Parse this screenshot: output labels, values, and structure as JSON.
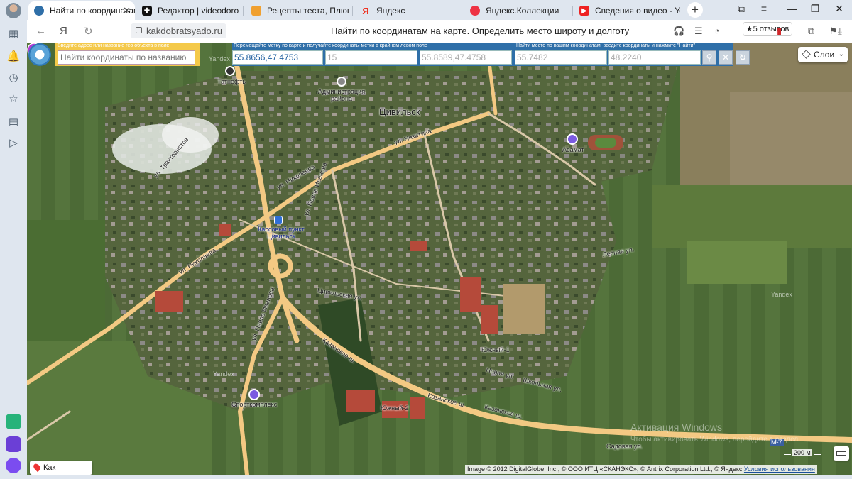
{
  "tabs": [
    {
      "label": "Найти по координатам",
      "favicon": "kakdobratsyado-icon",
      "active": true
    },
    {
      "label": "Редактор | videodorogros",
      "favicon": "zen-editor-icon"
    },
    {
      "label": "Рецепты теста, Плюшка к",
      "favicon": "recipe-site-icon"
    },
    {
      "label": "Яндекс",
      "favicon": "yandex-icon"
    },
    {
      "label": "Яндекс.Коллекции",
      "favicon": "yandex-collections-icon"
    },
    {
      "label": "Сведения о видео - YouT",
      "favicon": "youtube-icon"
    }
  ],
  "address_bar": {
    "url": "kakdobratsyado.ru",
    "page_title": "Найти по координатам на карте. Определить место широту и долготу",
    "reviews": "★5 отзывов"
  },
  "search_panel": {
    "caption": "Введите адрес или название гео объекта в поле",
    "placeholder": "Найти координаты по названию"
  },
  "coord_panel": {
    "caption_move": "Перемещайте метку по карте и получайте координаты метки в крайнем левом поле",
    "marker_coords": "55.8656,47.4753",
    "zoom": "15",
    "center_coords": "55.8589,47.4758",
    "caption_find": "Найти место по вашим координатам, введите координаты и нажмите \"Найти\"",
    "lat_placeholder": "55.7482",
    "lon_placeholder": "48.2240"
  },
  "map": {
    "layers_label": "Слои",
    "how_to_get": "Как добраться",
    "scale": "200 м",
    "copyright": "Image © 2012 DigitalGlobe, Inc., © ООО ИТЦ «СКАНЭКС», © Antrix Corporation Ltd., © Яндекс",
    "terms": "Условия использования",
    "watermark": "Активация Windows",
    "watermark_sub": "Чтобы активировать Windows, перейдите в раздел",
    "labels": {
      "city": "Цивильск",
      "admin": "Администрация района",
      "asamat": "Асамат",
      "kassa": "Кассовый пункт Цивильск",
      "sport": "Спорткомплекс",
      "nikitina": "ул. Никитина",
      "nikolaeva1": "ул. Николаева",
      "nikolaeva2": "ул. Николаева",
      "ivanova": "ул. Павла Иванова",
      "ivanova2": "ул. Павла Иванова",
      "kazan1": "Казанское ш.",
      "kazan2": "Казанское ш.",
      "kazan3": "Казанское ш.",
      "tsivil": "Цивильская ул.",
      "shkol": "Школьная ул.",
      "novaya": "Новая ул.",
      "lesnaya": "Лесная ул.",
      "sadovaya": "Садовая ул.",
      "yuzhny1": "Южный-1",
      "yuzhny2": "Южный-2",
      "traktor": "ул. Трактористов",
      "tatneft": "Татнефть",
      "yandex1": "Yandex",
      "yandex2": "Yandex",
      "yandex3": "Yandex",
      "m7": "М-7"
    }
  }
}
